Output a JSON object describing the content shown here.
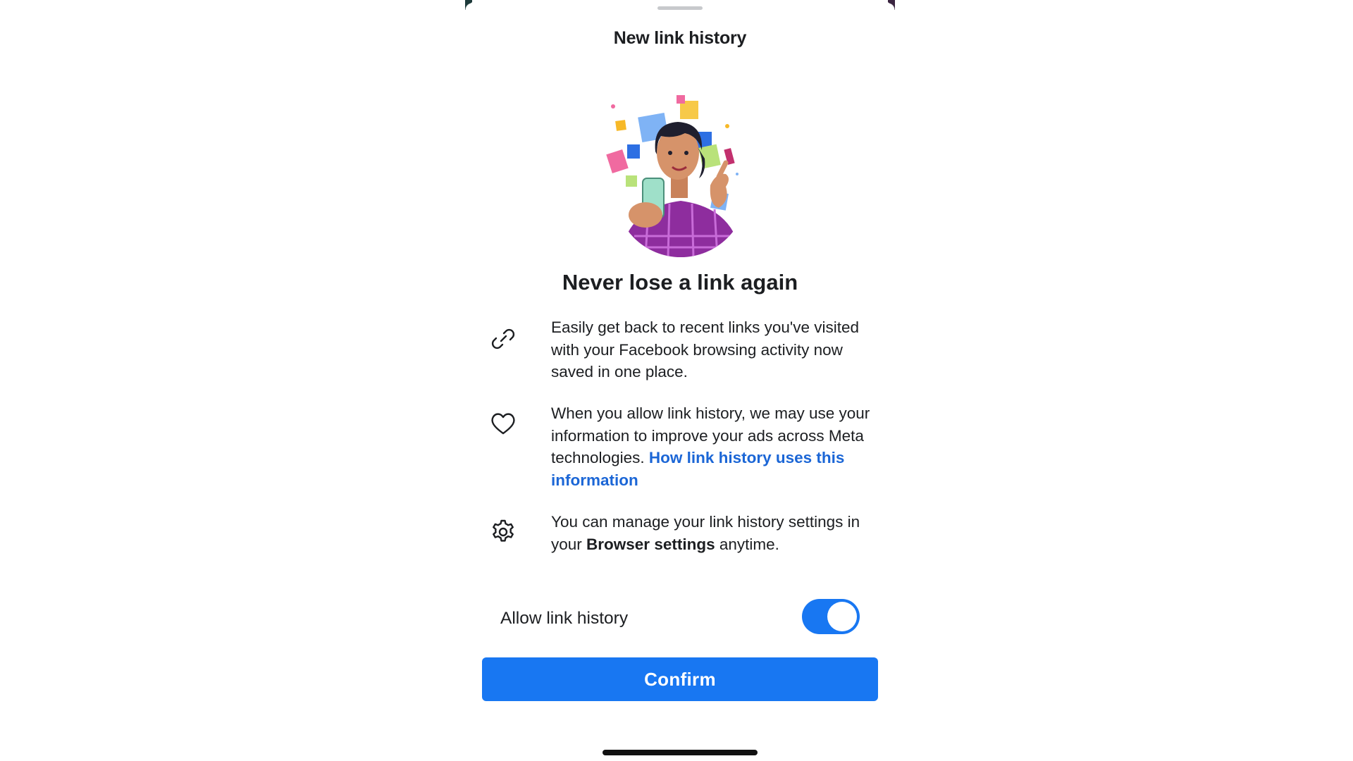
{
  "sheet": {
    "title": "New link history",
    "headline": "Never lose a link again"
  },
  "features": [
    {
      "icon": "link-icon",
      "text": "Easily get back to recent links you've visited with your Facebook browsing activity now saved in one place."
    },
    {
      "icon": "heart-icon",
      "text": "When you allow link history, we may use your information to improve your ads across Meta technologies. ",
      "link": "How link history uses this information"
    },
    {
      "icon": "gear-icon",
      "text_before": "You can manage your link history settings in your ",
      "text_bold": "Browser settings",
      "text_after": " anytime."
    }
  ],
  "toggle": {
    "label": "Allow link history",
    "state": "on"
  },
  "confirm_label": "Confirm",
  "colors": {
    "accent": "#1877f2",
    "link": "#1b66d6",
    "text": "#1c1e21"
  }
}
